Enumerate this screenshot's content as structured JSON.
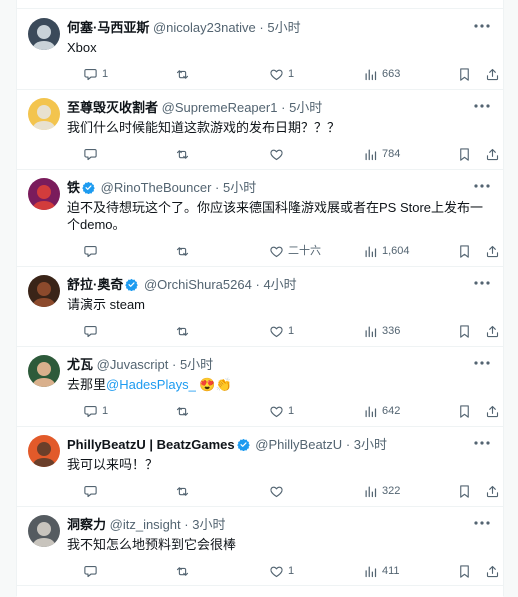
{
  "replies": [
    {
      "name": "何塞·马西亚斯",
      "handle": "@nicolay23native",
      "time": "5小时",
      "verified": false,
      "text_parts": [
        {
          "t": "Xbox",
          "m": false
        }
      ],
      "stats": {
        "reply": "1",
        "retweet": "",
        "like": "1",
        "views": "663"
      },
      "avatar_colors": [
        "#3b4a5a",
        "#c9d2d8"
      ]
    },
    {
      "name": "至尊毁灭收割者",
      "handle": "@SupremeReaper1",
      "time": "5小时",
      "verified": false,
      "text_parts": [
        {
          "t": "我们什么时候能知道这款游戏的发布日期？？？",
          "m": false
        }
      ],
      "stats": {
        "reply": "",
        "retweet": "",
        "like": "",
        "views": "784"
      },
      "avatar_colors": [
        "#f3c44e",
        "#e8e1d0"
      ]
    },
    {
      "name": "铁",
      "handle": "@RinoTheBouncer",
      "time": "5小时",
      "verified": true,
      "text_parts": [
        {
          "t": "迫不及待想玩这个了。你应该来德国科隆游戏展或者在PS Store上发布一个demo。",
          "m": false
        }
      ],
      "stats": {
        "reply": "",
        "retweet": "",
        "like": "二十六",
        "views": "1,604"
      },
      "avatar_colors": [
        "#7a1c5c",
        "#d23c3c"
      ]
    },
    {
      "name": "舒拉·奥奇",
      "handle": "@OrchiShura5264",
      "time": "4小时",
      "verified": true,
      "text_parts": [
        {
          "t": "请演示 steam",
          "m": false
        }
      ],
      "stats": {
        "reply": "",
        "retweet": "",
        "like": "1",
        "views": "336"
      },
      "avatar_colors": [
        "#3a2418",
        "#8c4a2c"
      ]
    },
    {
      "name": "尤瓦",
      "handle": "@Juvascript",
      "time": "5小时",
      "verified": false,
      "text_parts": [
        {
          "t": "去那里",
          "m": false
        },
        {
          "t": "@HadesPlays_",
          "m": true
        },
        {
          "t": " 😍👏",
          "m": false
        }
      ],
      "stats": {
        "reply": "1",
        "retweet": "",
        "like": "1",
        "views": "642"
      },
      "avatar_colors": [
        "#2d5a3a",
        "#d9b08c"
      ]
    },
    {
      "name": "PhillyBeatzU | BeatzGames",
      "handle": "@PhillyBeatzU",
      "time": "3小时",
      "verified": true,
      "text_parts": [
        {
          "t": "我可以来吗！？",
          "m": false
        }
      ],
      "stats": {
        "reply": "",
        "retweet": "",
        "like": "",
        "views": "322"
      },
      "avatar_colors": [
        "#e25a2a",
        "#6b3f2a"
      ]
    },
    {
      "name": "洞察力",
      "handle": "@itz_insight",
      "time": "3小时",
      "verified": false,
      "text_parts": [
        {
          "t": "我不知怎么地预料到它会很棒",
          "m": false
        }
      ],
      "stats": {
        "reply": "",
        "retweet": "",
        "like": "1",
        "views": "411"
      },
      "avatar_colors": [
        "#555b60",
        "#c8c4bd"
      ]
    }
  ],
  "dot": "·",
  "colors": {
    "accent": "#1d9bf0",
    "muted": "#536471",
    "text": "#0f1419",
    "verified": "#1d9bf0"
  }
}
